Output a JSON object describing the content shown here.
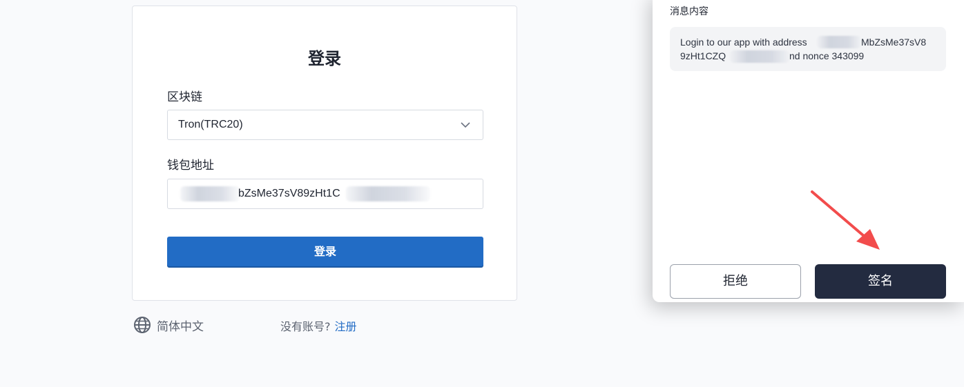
{
  "login": {
    "title": "登录",
    "chain_label": "区块链",
    "chain_value": "Tron(TRC20)",
    "wallet_label": "钱包地址",
    "wallet_value": "bZsMe37sV89zHt1C",
    "submit_label": "登录"
  },
  "footer": {
    "language": "简体中文",
    "no_account": "没有账号?",
    "register": "注册"
  },
  "wallet_popup": {
    "message_label": "消息内容",
    "message_line1_a": "Login to our app with address",
    "message_line1_b": "MbZsMe37sV8",
    "message_line2_a": "9zHt1CZQ",
    "message_line2_b": "nd nonce 343099",
    "reject_label": "拒绝",
    "sign_label": "签名"
  },
  "colors": {
    "primary": "#226cc5",
    "sign_button": "#232b40",
    "annotation_arrow": "#f24c4c"
  }
}
